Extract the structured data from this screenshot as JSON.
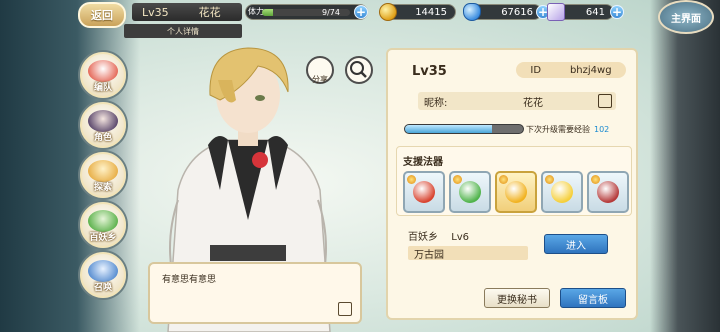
{
  "top": {
    "back_label": "返回",
    "player_level": "Lv35",
    "player_name": "花花",
    "profile_tab": "个人详情",
    "stamina_label": "体力",
    "stamina_value": "9/74",
    "stamina_fill": 0.12,
    "coins": "14415",
    "gems": "67616",
    "tickets": "641",
    "main_label": "主界面"
  },
  "nav": {
    "items": [
      {
        "label": "编队",
        "color": "#e56b5b"
      },
      {
        "label": "角色",
        "color": "#5d4a6e"
      },
      {
        "label": "探索",
        "color": "#e8b04a"
      },
      {
        "label": "百妖乡",
        "color": "#5fb34f"
      },
      {
        "label": "召唤",
        "color": "#5a8fd1"
      }
    ]
  },
  "dialog": {
    "text": "有意思有意思"
  },
  "panel": {
    "level": "Lv35",
    "id_label": "ID",
    "id_value": "bhzj4wg",
    "nickname_label": "昵称:",
    "nickname_value": "花花",
    "xp_fill": 0.74,
    "xp_label": "下次升级需要经验",
    "xp_needed": "102",
    "artifacts_title": "支援法器",
    "artifacts": [
      {
        "name": "red-dragon-artifact",
        "color": "#d8432f",
        "gold": false
      },
      {
        "name": "green-beast-artifact",
        "color": "#4fb34a",
        "gold": false
      },
      {
        "name": "golden-ring-artifact",
        "color": "#f1b21f",
        "gold": true
      },
      {
        "name": "yellow-lantern-artifact",
        "color": "#f5cf3a",
        "gold": false
      },
      {
        "name": "umbrella-artifact",
        "color": "#b53a3a",
        "gold": false
      }
    ],
    "village_label": "百妖乡",
    "village_level": "Lv6",
    "village_sub": "万古园",
    "enter_label": "进入",
    "swap_label": "更换秘书",
    "message_label": "留言板"
  },
  "buttons": {
    "share_label": "分享"
  }
}
